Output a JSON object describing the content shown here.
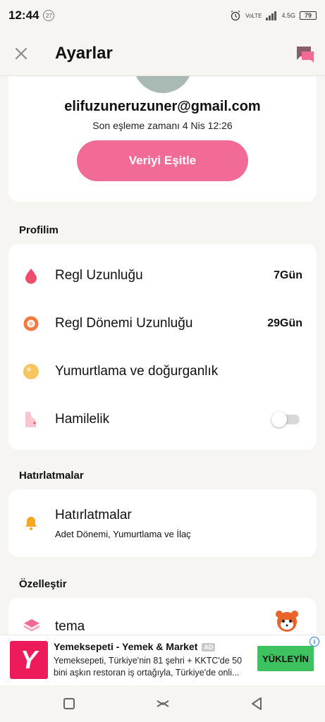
{
  "status_bar": {
    "time": "12:44",
    "notif_count": "27",
    "network": "4.5G",
    "battery": "79"
  },
  "app_bar": {
    "title": "Ayarlar"
  },
  "account": {
    "email": "elifuzuneruzuner@gmail.com",
    "sync_time": "Son eşleme zamanı 4 Nis 12:26",
    "sync_button": "Veriyi Eşitle"
  },
  "profile": {
    "section_title": "Profilim",
    "items": [
      {
        "label": "Regl Uzunluğu",
        "value": "7Gün",
        "icon": "drop-icon"
      },
      {
        "label": "Regl Dönemi Uzunluğu",
        "value": "29Gün",
        "icon": "cycle-ring-icon"
      },
      {
        "label": "Yumurtlama ve doğurganlık",
        "value": "",
        "icon": "ovulation-icon"
      },
      {
        "label": "Hamilelik",
        "toggle": false,
        "icon": "pregnancy-icon"
      }
    ]
  },
  "reminders": {
    "section_title": "Hatırlatmalar",
    "title": "Hatırlatmalar",
    "subtitle": "Adet Dönemi, Yumurtlama ve İlaç"
  },
  "customize": {
    "section_title": "Özelleştir",
    "theme_label": "tema"
  },
  "ad": {
    "title": "Yemeksepeti - Yemek & Market",
    "tag": "AD",
    "description": "Yemeksepeti, Türkiye'nin 81 şehri + KKTC'de 50 bini aşkın restoran iş ortağıyla, Türkiye'de onli...",
    "button": "YÜKLEYİN",
    "logo_letter": "Y"
  },
  "colors": {
    "accent": "#f26b96",
    "ad_button": "#3cc25e",
    "ad_brand": "#ee1b5b"
  }
}
